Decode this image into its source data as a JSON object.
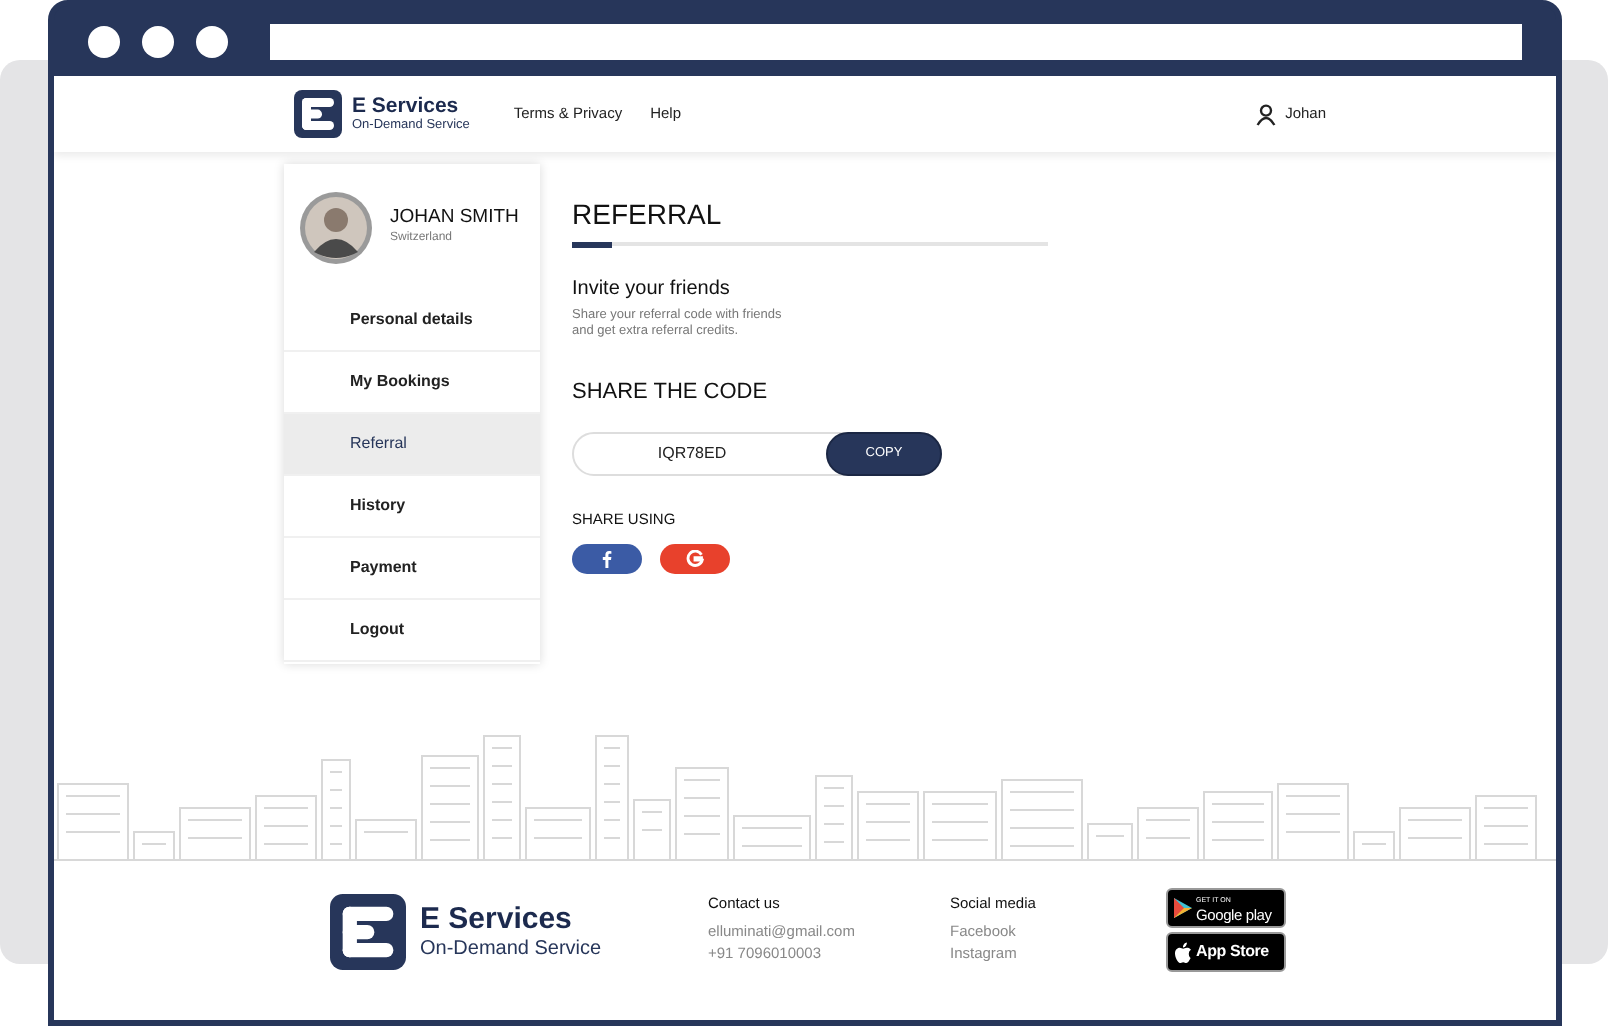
{
  "header": {
    "brand": {
      "name": "E Services",
      "tagline": "On-Demand Service"
    },
    "nav": [
      "Terms & Privacy",
      "Help"
    ],
    "user": "Johan"
  },
  "profile": {
    "name": "JOHAN SMITH",
    "country": "Switzerland"
  },
  "sidebar": {
    "items": [
      {
        "label": "Personal details",
        "selected": false
      },
      {
        "label": "My Bookings",
        "selected": false
      },
      {
        "label": "Referral",
        "selected": true
      },
      {
        "label": "History",
        "selected": false
      },
      {
        "label": "Payment",
        "selected": false
      },
      {
        "label": "Logout",
        "selected": false
      }
    ]
  },
  "referral": {
    "title": "REFERRAL",
    "invite_title": "Invite your friends",
    "invite_text": "Share your referral code with friends\nand get extra referral credits.",
    "share_code_title": "SHARE THE CODE",
    "code": "IQR78ED",
    "copy_button": "COPY",
    "share_using": "SHARE USING",
    "share_buttons": [
      {
        "kind": "facebook",
        "color": "#3b5ba5"
      },
      {
        "kind": "google",
        "color": "#e8412c"
      }
    ]
  },
  "footer": {
    "brand": {
      "name": "E Services",
      "tagline": "On-Demand Service"
    },
    "contact": {
      "title": "Contact us",
      "lines": [
        "elluminati@gmail.com",
        "+91 7096010003"
      ]
    },
    "social": {
      "title": "Social media",
      "links": [
        "Facebook",
        "Instagram"
      ]
    },
    "stores": [
      {
        "kind": "google",
        "small": "GET IT ON",
        "name": "Google play"
      },
      {
        "kind": "apple",
        "name": "App Store"
      }
    ]
  }
}
